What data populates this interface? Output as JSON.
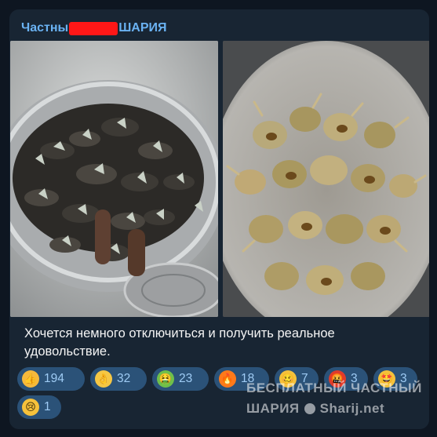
{
  "post": {
    "channel_start": "Частны",
    "channel_end": "ШАРИЯ",
    "caption_line1": "Хочется немного отключиться и получить реальное",
    "caption_line2": "удовольствие.",
    "left_photo": {
      "subject": "barnacle-shellfish-in-colander"
    },
    "right_photo": {
      "subject": "sea-snail-shells-in-bowl"
    }
  },
  "reactions": [
    {
      "icon": "thumbs-up-icon",
      "color": "#f6b93b",
      "count": "194"
    },
    {
      "icon": "ok-hand-icon",
      "color": "#f6c744",
      "count": "32"
    },
    {
      "icon": "vomit-icon",
      "color": "#6fbf4a",
      "count": "23"
    },
    {
      "icon": "fire-icon",
      "color": "#ff7a1a",
      "count": "18"
    },
    {
      "icon": "woozy-face-icon",
      "color": "#f5c13b",
      "count": "7"
    },
    {
      "icon": "cursing-face-icon",
      "color": "#e03b2b",
      "count": "3"
    },
    {
      "icon": "star-struck-icon",
      "color": "#f5c13b",
      "count": "3"
    },
    {
      "icon": "crying-face-icon",
      "color": "#f5c13b",
      "count": "1"
    }
  ],
  "watermark": {
    "line1": "БЕСПЛАТНЫЙ ЧАСТНЫЙ",
    "line2": "ШАРИЯ",
    "site": "Sharij.net"
  }
}
